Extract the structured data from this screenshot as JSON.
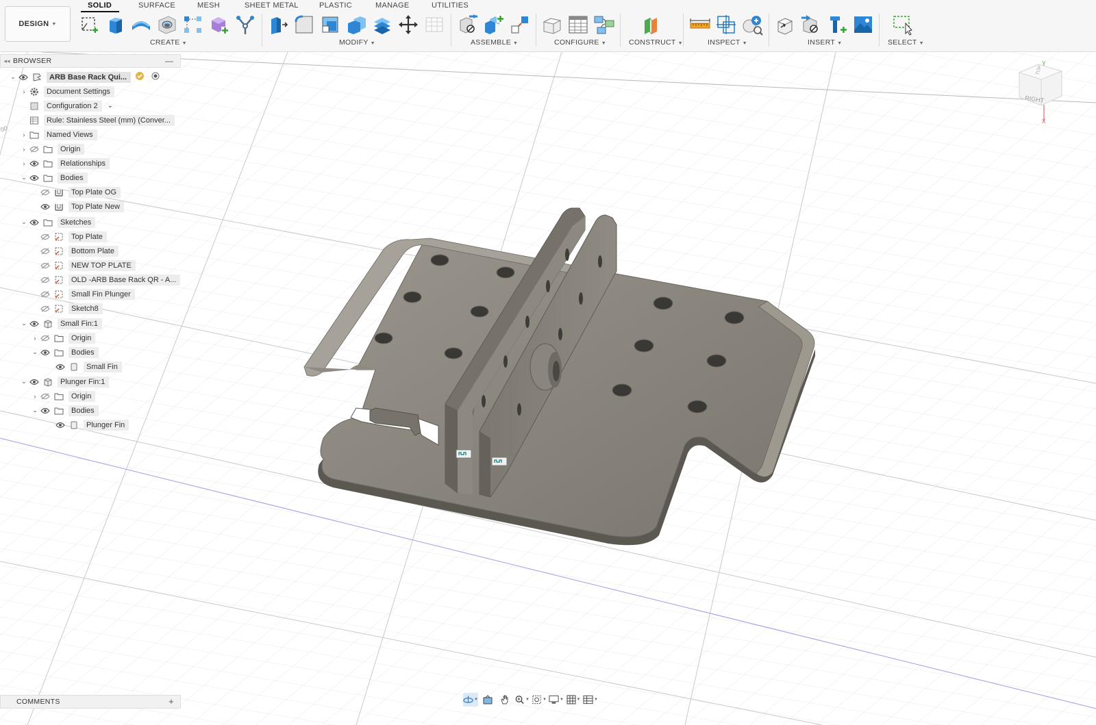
{
  "workspace": {
    "label": "DESIGN"
  },
  "tabs": [
    {
      "label": "SOLID",
      "active": true
    },
    {
      "label": "SURFACE",
      "active": false
    },
    {
      "label": "MESH",
      "active": false
    },
    {
      "label": "SHEET METAL",
      "active": false
    },
    {
      "label": "PLASTIC",
      "active": false
    },
    {
      "label": "MANAGE",
      "active": false
    },
    {
      "label": "UTILITIES",
      "active": false
    }
  ],
  "groups": {
    "create": "CREATE",
    "modify": "MODIFY",
    "assemble": "ASSEMBLE",
    "configure": "CONFIGURE",
    "construct": "CONSTRUCT",
    "inspect": "INSPECT",
    "insert": "INSERT",
    "select": "SELECT"
  },
  "browser": {
    "title": "BROWSER",
    "root": "ARB Base Rack Qui...",
    "items": {
      "document_settings": "Document Settings",
      "configuration": "Configuration 2",
      "rule": "Rule: Stainless Steel (mm) (Conver...",
      "named_views": "Named Views",
      "origin": "Origin",
      "relationships": "Relationships",
      "bodies": "Bodies",
      "top_plate_og": "Top Plate OG",
      "top_plate_new": "Top Plate New",
      "sketches": "Sketches",
      "sk_top_plate": "Top Plate",
      "sk_bottom_plate": "Bottom Plate",
      "sk_new_top_plate": "NEW TOP PLATE",
      "sk_old_arb": "OLD -ARB Base Rack QR - A...",
      "sk_small_fin_plunger": "Small Fin Plunger",
      "sk_sketch8": "Sketch8",
      "small_fin_comp": "Small Fin:1",
      "small_fin_origin": "Origin",
      "small_fin_bodies": "Bodies",
      "small_fin_body": "Small Fin",
      "plunger_fin_comp": "Plunger Fin:1",
      "plunger_fin_origin": "Origin",
      "plunger_fin_bodies": "Bodies",
      "plunger_fin_body": "Plunger Fin"
    }
  },
  "comments": {
    "title": "COMMENTS"
  },
  "viewcube": {
    "face_right": "RIGHT",
    "face_top": "TOP",
    "axis_y": "Y",
    "axis_x": "X"
  },
  "viewport": {
    "grid_label": "00"
  },
  "colors": {
    "accent": "#0696d7",
    "body": "#8e8a82",
    "body_dark": "#6e6a63",
    "tab_active": "#111111"
  },
  "icons": [
    "sketch-icon",
    "extrude-icon",
    "revolve-icon",
    "hole-icon",
    "pattern-icon",
    "box-icon",
    "joint-icon",
    "press-pull-icon",
    "fillet-icon",
    "shell-icon",
    "combine-icon",
    "move-icon",
    "parameters-icon",
    "measure-icon",
    "select-icon"
  ]
}
